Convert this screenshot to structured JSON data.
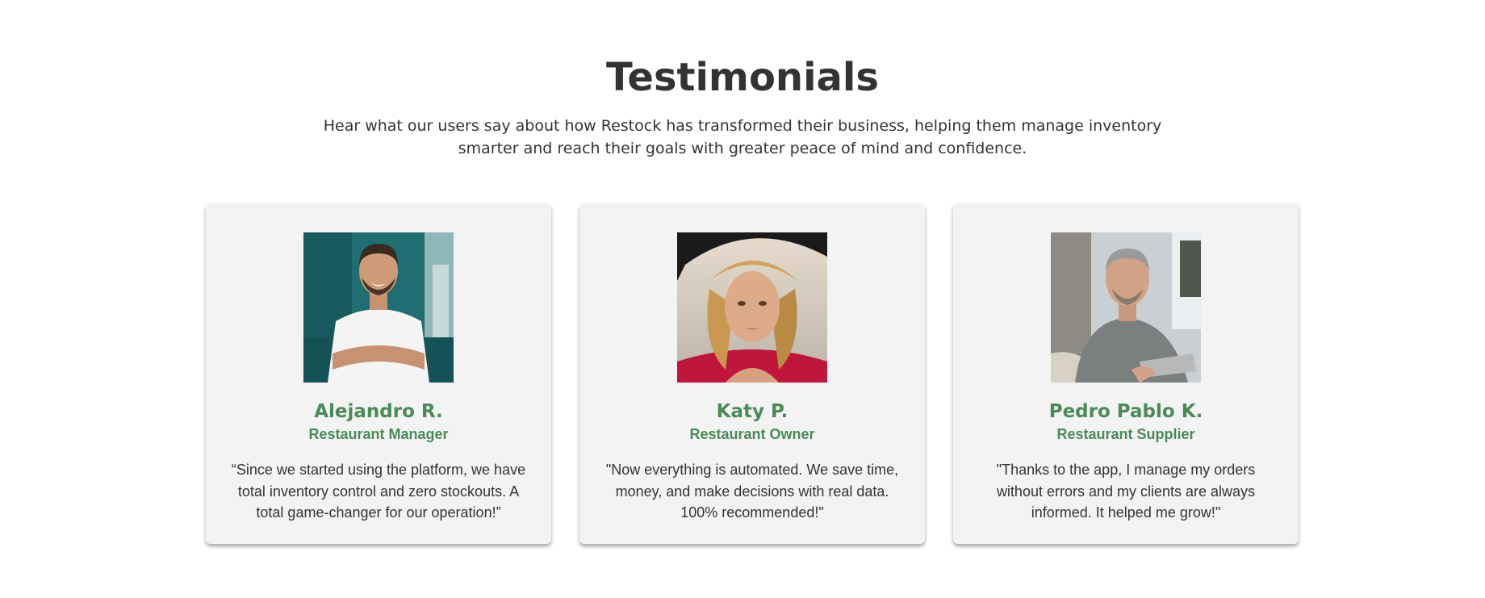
{
  "section": {
    "title": "Testimonials",
    "subtitle": "Hear what our users say about how Restock has transformed their business, helping them manage inventory smarter and reach their goals with greater peace of mind and confidence."
  },
  "colors": {
    "accent": "#4a8a57",
    "card_background": "#f3f3f3",
    "text": "#333333"
  },
  "testimonials": [
    {
      "name": "Alejandro R.",
      "role": "Restaurant Manager",
      "quote": "“Since we started using the platform, we have total inventory control and zero stockouts. A total game-changer for our operation!”",
      "photo": "man-white-tshirt-photo"
    },
    {
      "name": "Katy P.",
      "role": "Restaurant Owner",
      "quote": "\"Now everything is automated. We save time, money, and make decisions with real data. 100% recommended!\"",
      "photo": "woman-black-hat-photo"
    },
    {
      "name": "Pedro Pablo K.",
      "role": "Restaurant Supplier",
      "quote": "\"Thanks to the app, I manage my orders without errors and my clients are always informed. It helped me grow!\"",
      "photo": "man-with-tablet-photo"
    }
  ]
}
